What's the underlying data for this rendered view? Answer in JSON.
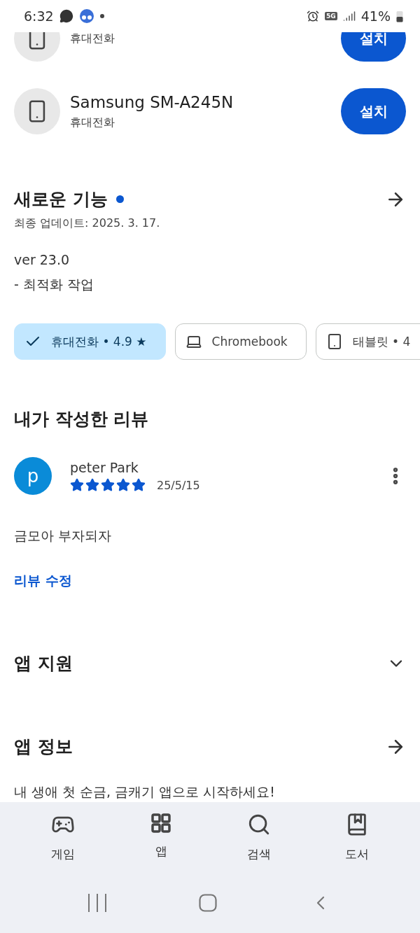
{
  "status_bar": {
    "time": "6:32",
    "network": "5G",
    "battery": "41%"
  },
  "devices": [
    {
      "subtitle": "휴대전화",
      "button": "설치"
    },
    {
      "name": "Samsung SM-A245N",
      "subtitle": "휴대전화",
      "button": "설치"
    }
  ],
  "whats_new": {
    "title": "새로운 기능",
    "updated": "최종 업데이트: 2025. 3. 17.",
    "notes": [
      "ver 23.0",
      "- 최적화 작업"
    ]
  },
  "chips": [
    {
      "label": "휴대전화 • 4.9 ★",
      "selected": true
    },
    {
      "label": "Chromebook",
      "selected": false
    },
    {
      "label": "태블릿 • 4",
      "selected": false
    }
  ],
  "review_section": {
    "title": "내가 작성한 리뷰",
    "author": "peter Park",
    "avatar": "p",
    "stars": 5,
    "date": "25/5/15",
    "text": "금모아 부자되자",
    "edit_link": "리뷰 수정"
  },
  "support": {
    "title": "앱 지원",
    "expanded": false
  },
  "app_info": {
    "title": "앱 정보",
    "description": "내 생애 첫 순금, 금캐기 앱으로 시작하세요!"
  },
  "bottom_nav": [
    {
      "label": "게임"
    },
    {
      "label": "앱"
    },
    {
      "label": "검색"
    },
    {
      "label": "도서"
    }
  ]
}
